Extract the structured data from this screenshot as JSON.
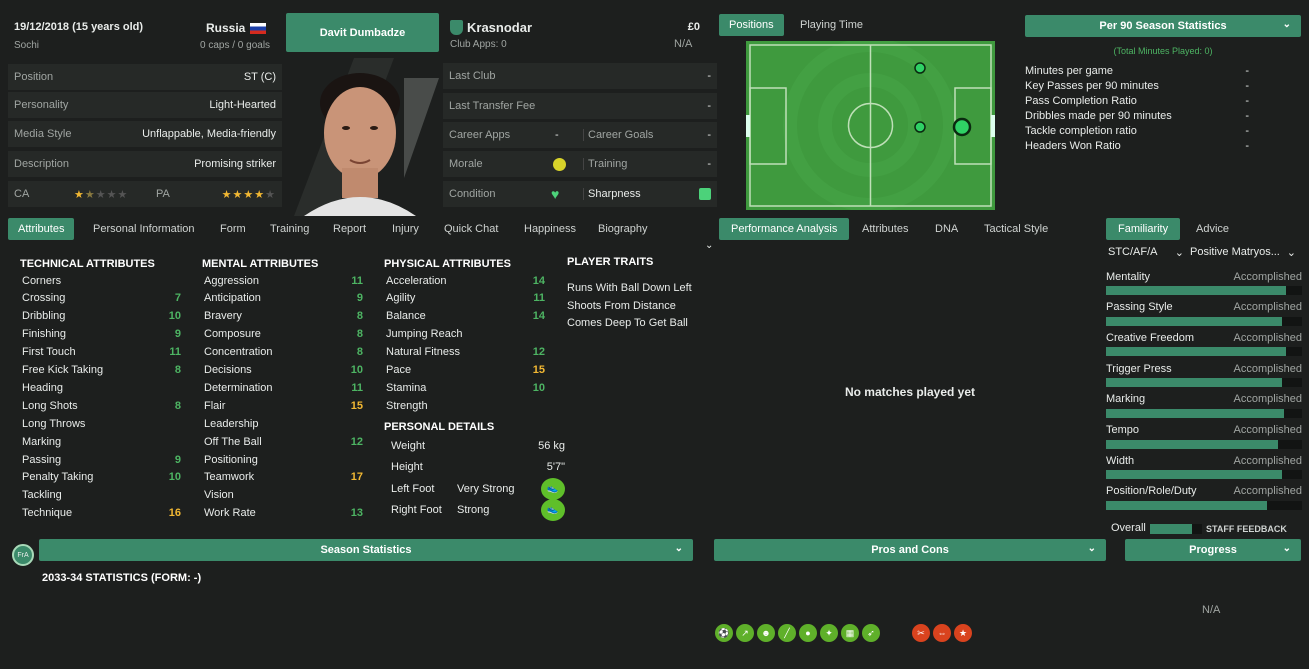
{
  "player": {
    "dob": "19/12/2018 (15 years old)",
    "birthplace": "Sochi",
    "nation": "Russia",
    "caps": "0 caps / 0 goals",
    "name": "Davit Dumbadze",
    "club": "Krasnodar",
    "club_apps": "Club Apps: 0",
    "value": "£0",
    "wage": "N/A"
  },
  "info": [
    {
      "label": "Position",
      "value": "ST (C)"
    },
    {
      "label": "Personality",
      "value": "Light-Hearted"
    },
    {
      "label": "Media Style",
      "value": "Unflappable, Media-friendly"
    },
    {
      "label": "Description",
      "value": "Promising striker"
    }
  ],
  "ratings": {
    "ca_label": "CA",
    "pa_label": "PA",
    "ca_stars": 1.5,
    "pa_stars": 4
  },
  "career": {
    "last_club": "Last Club",
    "last_club_v": "-",
    "last_fee": "Last Transfer Fee",
    "last_fee_v": "-",
    "apps": "Career Apps",
    "apps_v": "-",
    "goals": "Career Goals",
    "goals_v": "-",
    "morale": "Morale",
    "training": "Training",
    "training_v": "-",
    "condition": "Condition",
    "sharpness": "Sharpness"
  },
  "tabs": [
    "Attributes",
    "Personal Information",
    "Form",
    "Training",
    "Report",
    "Injury",
    "Quick Chat",
    "Happiness",
    "Biography"
  ],
  "pitch_tabs": [
    "Positions",
    "Playing Time"
  ],
  "technical": {
    "title": "TECHNICAL ATTRIBUTES",
    "items": [
      [
        "Corners",
        ""
      ],
      [
        "Crossing",
        "7"
      ],
      [
        "Dribbling",
        "10"
      ],
      [
        "Finishing",
        "9"
      ],
      [
        "First Touch",
        "11"
      ],
      [
        "Free Kick Taking",
        "8"
      ],
      [
        "Heading",
        ""
      ],
      [
        "Long Shots",
        "8"
      ],
      [
        "Long Throws",
        ""
      ],
      [
        "Marking",
        ""
      ],
      [
        "Passing",
        "9"
      ],
      [
        "Penalty Taking",
        "10"
      ],
      [
        "Tackling",
        ""
      ],
      [
        "Technique",
        "16"
      ]
    ]
  },
  "mental": {
    "title": "MENTAL ATTRIBUTES",
    "items": [
      [
        "Aggression",
        "11"
      ],
      [
        "Anticipation",
        "9"
      ],
      [
        "Bravery",
        "8"
      ],
      [
        "Composure",
        "8"
      ],
      [
        "Concentration",
        "8"
      ],
      [
        "Decisions",
        "10"
      ],
      [
        "Determination",
        "11"
      ],
      [
        "Flair",
        "15"
      ],
      [
        "Leadership",
        ""
      ],
      [
        "Off The Ball",
        "12"
      ],
      [
        "Positioning",
        ""
      ],
      [
        "Teamwork",
        "17"
      ],
      [
        "Vision",
        ""
      ],
      [
        "Work Rate",
        "13"
      ]
    ]
  },
  "physical": {
    "title": "PHYSICAL ATTRIBUTES",
    "items": [
      [
        "Acceleration",
        "14"
      ],
      [
        "Agility",
        "11"
      ],
      [
        "Balance",
        "14"
      ],
      [
        "Jumping Reach",
        ""
      ],
      [
        "Natural Fitness",
        "12"
      ],
      [
        "Pace",
        "15"
      ],
      [
        "Stamina",
        "10"
      ],
      [
        "Strength",
        ""
      ]
    ]
  },
  "personal": {
    "title": "PERSONAL DETAILS",
    "weight_l": "Weight",
    "weight": "56 kg",
    "height_l": "Height",
    "height": "5'7\"",
    "lf_l": "Left Foot",
    "lf": "Very Strong",
    "rf_l": "Right Foot",
    "rf": "Strong"
  },
  "traits": {
    "title": "PLAYER TRAITS",
    "items": [
      "Runs With Ball Down Left",
      "Shoots From Distance",
      "Comes Deep To Get Ball"
    ]
  },
  "per90": {
    "title": "Per 90 Season Statistics",
    "sub": "(Total Minutes Played: 0)",
    "items": [
      [
        "Minutes per game",
        "-"
      ],
      [
        "Key Passes per 90 minutes",
        "-"
      ],
      [
        "Pass Completion Ratio",
        "-"
      ],
      [
        "Dribbles made per 90 minutes",
        "-"
      ],
      [
        "Tackle completion ratio",
        "-"
      ],
      [
        "Headers Won Ratio",
        "-"
      ]
    ]
  },
  "perf_tabs": [
    "Performance Analysis",
    "Attributes",
    "DNA",
    "Tactical Style"
  ],
  "no_matches": "No matches played yet",
  "fam_tabs": [
    "Familiarity",
    "Advice"
  ],
  "fam_selects": [
    "STC/AF/A",
    "Positive Matryos..."
  ],
  "familiarity": [
    [
      "Mentality",
      "Accomplished",
      0.92
    ],
    [
      "Passing Style",
      "Accomplished",
      0.9
    ],
    [
      "Creative Freedom",
      "Accomplished",
      0.92
    ],
    [
      "Trigger Press",
      "Accomplished",
      0.9
    ],
    [
      "Marking",
      "Accomplished",
      0.91
    ],
    [
      "Tempo",
      "Accomplished",
      0.88
    ],
    [
      "Width",
      "Accomplished",
      0.9
    ],
    [
      "Position/Role/Duty",
      "Accomplished",
      0.82
    ]
  ],
  "overall": "Overall",
  "staff_feedback": "STAFF FEEDBACK",
  "bottom": {
    "badge": "FrA",
    "season": "Season Statistics",
    "pros": "Pros and Cons",
    "progress": "Progress",
    "stats": "2033-34 STATISTICS (FORM: -)",
    "na": "N/A"
  },
  "colors": {
    "accent": "#3b8a6a",
    "green": "#4db463",
    "yellow": "#f2b833"
  }
}
